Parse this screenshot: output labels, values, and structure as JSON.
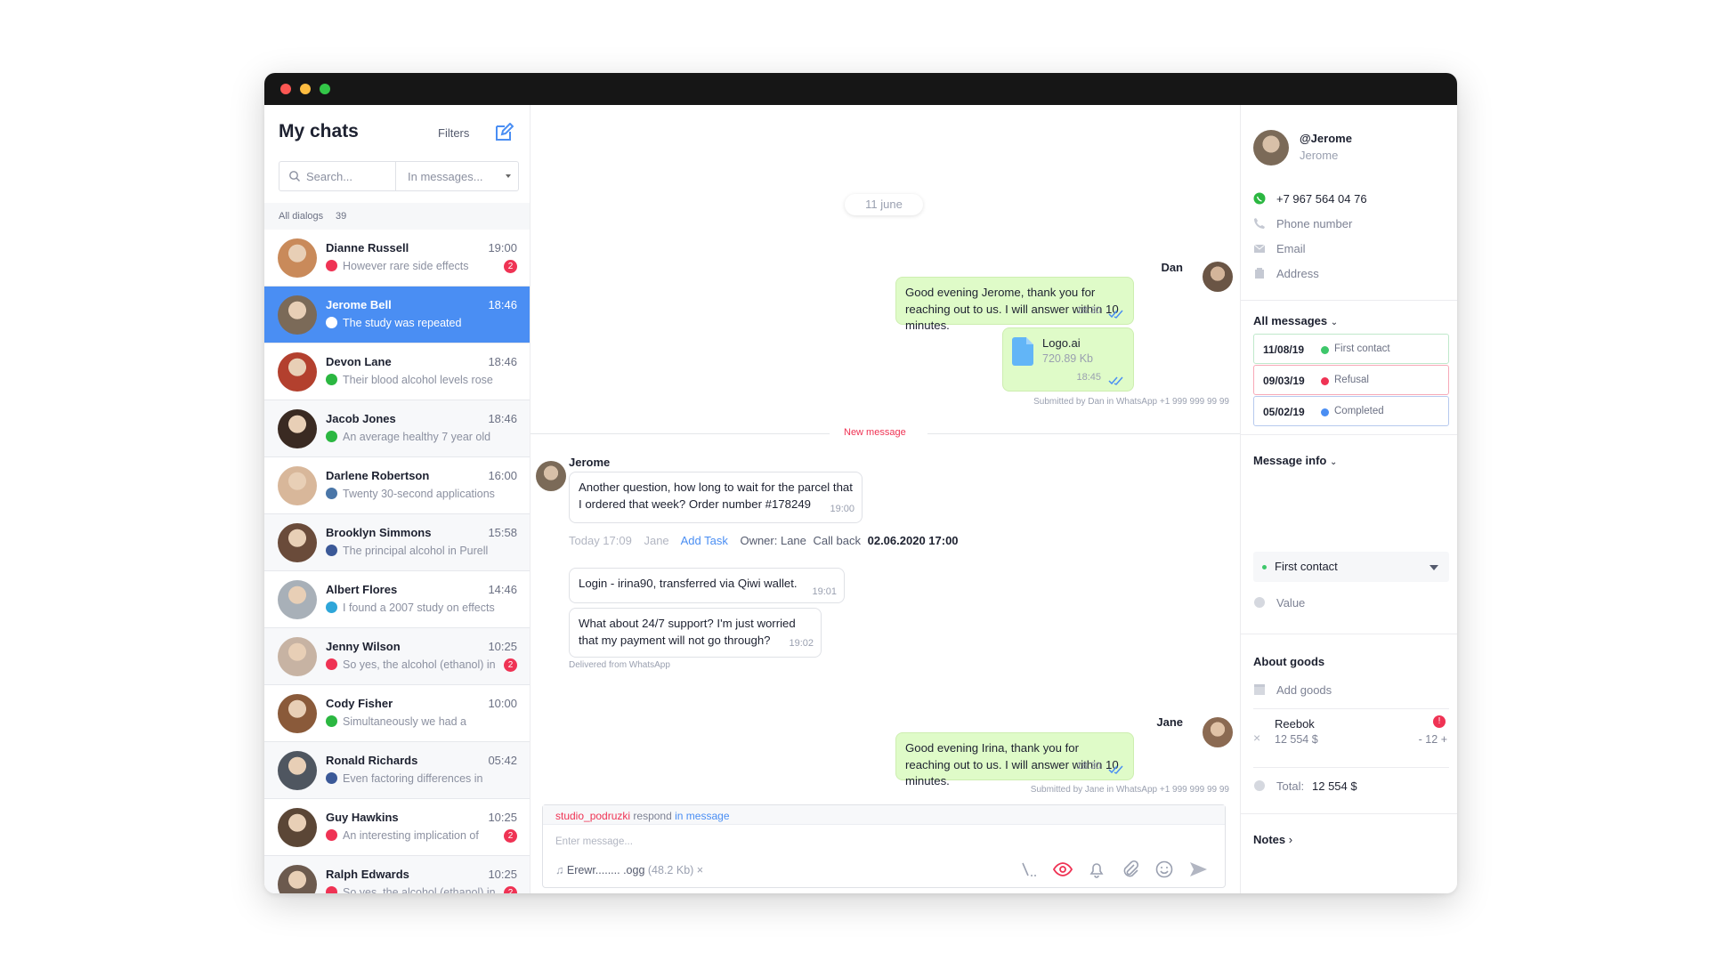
{
  "sidebar": {
    "title": "My chats",
    "filters_label": "Filters",
    "search_placeholder": "Search...",
    "search_scope": "In messages...",
    "all_dialogs_label": "All dialogs",
    "all_dialogs_count": "39",
    "chats": [
      {
        "name": "Dianne Russell",
        "time": "19:00",
        "preview": "However rare side effects",
        "channel": "instagram",
        "badge": "2",
        "avatar_color": "#c98a5a"
      },
      {
        "name": "Jerome Bell",
        "time": "18:46",
        "preview": "The study was repeated",
        "channel": "chat",
        "badge": "",
        "avatar_color": "#7b6a58",
        "active": true
      },
      {
        "name": "Devon Lane",
        "time": "18:46",
        "preview": "Their blood alcohol levels rose",
        "channel": "whatsapp",
        "badge": "",
        "avatar_color": "#b3402e"
      },
      {
        "name": "Jacob Jones",
        "time": "18:46",
        "preview": "An average healthy 7 year old",
        "channel": "whatsapp",
        "badge": "",
        "avatar_color": "#3a2a22"
      },
      {
        "name": "Darlene Robertson",
        "time": "16:00",
        "preview": "Twenty 30-second applications",
        "channel": "vk",
        "badge": "",
        "avatar_color": "#d8b79a"
      },
      {
        "name": "Brooklyn Simmons",
        "time": "15:58",
        "preview": "The principal alcohol in Purell",
        "channel": "facebook",
        "badge": "",
        "avatar_color": "#6a4b3a"
      },
      {
        "name": "Albert Flores",
        "time": "14:46",
        "preview": "I found a 2007 study on effects",
        "channel": "telegram",
        "badge": "",
        "avatar_color": "#a8b0b8"
      },
      {
        "name": "Jenny Wilson",
        "time": "10:25",
        "preview": "So yes, the alcohol (ethanol) in",
        "channel": "instagram",
        "badge": "2",
        "avatar_color": "#c7b3a3"
      },
      {
        "name": "Cody Fisher",
        "time": "10:00",
        "preview": "Simultaneously we had a",
        "channel": "whatsapp",
        "badge": "",
        "avatar_color": "#8a5a3a"
      },
      {
        "name": "Ronald Richards",
        "time": "05:42",
        "preview": "Even factoring differences in",
        "channel": "facebook",
        "badge": "",
        "avatar_color": "#4f5660"
      },
      {
        "name": "Guy Hawkins",
        "time": "10:25",
        "preview": "An interesting implication of",
        "channel": "instagram",
        "badge": "2",
        "avatar_color": "#5b4636"
      },
      {
        "name": "Ralph Edwards",
        "time": "10:25",
        "preview": "So yes, the alcohol (ethanol) in",
        "channel": "instagram",
        "badge": "2",
        "avatar_color": "#6c5a4e"
      }
    ]
  },
  "chat": {
    "date_label": "11 june",
    "msg1": {
      "sender": "Dan",
      "text": "Good evening Jerome, thank you for reaching out to us. I will answer within 10 minutes.",
      "time": "18:30"
    },
    "file": {
      "name": "Logo.ai",
      "size": "720.89 Kb",
      "time": "18:45"
    },
    "submitted_dan": "Submitted by Dan in WhatsApp +1 999 999 99 99",
    "new_message_label": "New message",
    "msg2": {
      "sender": "Jerome",
      "text": "Another question, how long to wait for the parcel that I ordered that week? Order number #178249",
      "time": "19:00"
    },
    "task": {
      "today": "Today 17:09",
      "agent": "Jane",
      "add_task": "Add Task",
      "owner": "Owner: Lane",
      "callback_label": "Call back",
      "callback_value": "02.06.2020 17:00"
    },
    "msg3": {
      "text": "Login - irina90, transferred via Qiwi wallet.",
      "time": "19:01"
    },
    "msg4": {
      "text": "What about 24/7 support? I'm just worried that my payment will not go through?",
      "time": "19:02"
    },
    "delivered": "Delivered from WhatsApp",
    "msg5": {
      "sender": "Jane",
      "text": "Good evening Irina, thank you for reaching out to us. I will answer within 10 minutes.",
      "time": "18:30"
    },
    "submitted_jane": "Submitted by Jane in WhatsApp +1 999 999 99 99"
  },
  "composer": {
    "account": "studio_podruzki",
    "respond": "respond",
    "in_message": "in message",
    "placeholder": "Enter message...",
    "attachment_name": "Erewr........ .ogg",
    "attachment_size": "(48.2 Kb)",
    "remove": "×"
  },
  "contact": {
    "handle": "@Jerome",
    "name": "Jerome",
    "whatsapp": "+7 967 564 04 76",
    "phone_placeholder": "Phone number",
    "email_placeholder": "Email",
    "address_placeholder": "Address",
    "all_messages": "All messages",
    "history": [
      {
        "date": "11/08/19",
        "status": "First contact",
        "color": "#3ec76b",
        "border": "#bfe8cb"
      },
      {
        "date": "09/03/19",
        "status": "Refusal",
        "color": "#ef3354",
        "border": "#f7a9b8"
      },
      {
        "date": "05/02/19",
        "status": "Completed",
        "color": "#4a8ef3",
        "border": "#b6c9ee"
      }
    ],
    "message_info": "Message info",
    "selected_status": "First contact",
    "value_placeholder": "Value",
    "about_goods": "About goods",
    "add_goods": "Add goods",
    "goods": {
      "name": "Reebok",
      "price": "12 554 $",
      "qty_minus": "-",
      "qty": "12",
      "qty_plus": "+"
    },
    "total_label": "Total:",
    "total_value": "12 554 $",
    "notes": "Notes"
  }
}
